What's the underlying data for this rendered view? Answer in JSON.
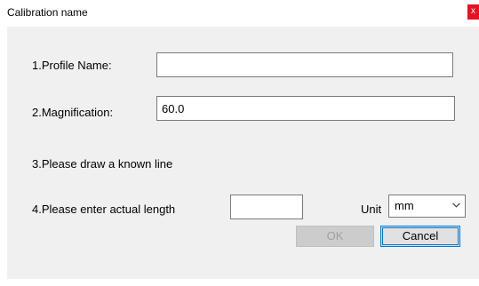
{
  "window": {
    "title": "Calibration name",
    "close_label": "x"
  },
  "form": {
    "profile_name": {
      "label": "1.Profile Name:",
      "value": ""
    },
    "magnification": {
      "label": "2.Magnification:",
      "value": "60.0"
    },
    "draw_instruction": "3.Please draw a known line",
    "actual_length": {
      "label": "4.Please enter actual length",
      "value": ""
    },
    "unit": {
      "label": "Unit",
      "selected": "mm"
    }
  },
  "buttons": {
    "ok_label": "OK",
    "ok_enabled": false,
    "cancel_label": "Cancel"
  },
  "icons": {
    "close": "close-icon",
    "dropdown": "chevron-down-icon"
  },
  "colors": {
    "close_button_bg": "#e81123",
    "client_bg": "#f0f0f0",
    "focus_border": "#0078d7",
    "disabled_text": "#a0a0a0"
  }
}
